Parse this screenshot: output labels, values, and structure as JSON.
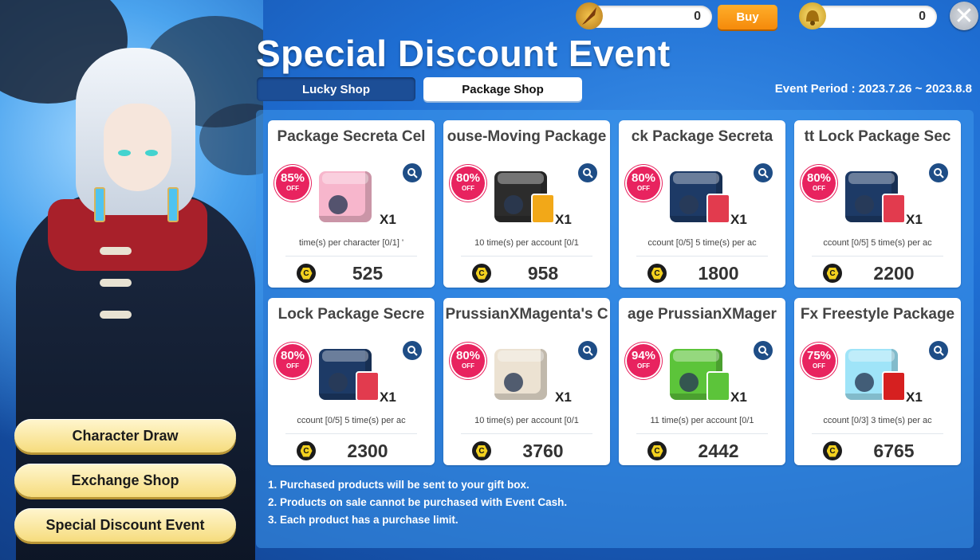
{
  "currency": [
    {
      "icon": "quill-pen-icon",
      "amount": "0"
    },
    {
      "icon": "gold-bell-icon",
      "amount": "0"
    }
  ],
  "buy_label": "Buy",
  "close_icon": "close-icon",
  "title": "Special Discount Event",
  "tabs": {
    "lucky": "Lucky Shop",
    "package": "Package Shop"
  },
  "event_period": "Event Period : 2023.7.26 ~ 2023.8.8",
  "side_menu": [
    "Character Draw",
    "Exchange Shop",
    "Special Discount Event"
  ],
  "off_label": "OFF",
  "products": [
    {
      "name": "Package     Secreta Cel",
      "discount": "85%",
      "qty": "X1",
      "limit": "time(s) per character [0/1]   '",
      "price": "525",
      "box_color": "#f7b6cc",
      "extra_color": ""
    },
    {
      "name": "ouse-Moving Package",
      "discount": "80%",
      "qty": "X1",
      "limit": "10 time(s) per account [0/1",
      "price": "958",
      "box_color": "#2c2c2c",
      "extra_color": "#f2a818"
    },
    {
      "name": "ck Package     Secreta",
      "discount": "80%",
      "qty": "X1",
      "limit": "ccount [0/5]    5 time(s) per ac",
      "price": "1800",
      "box_color": "#1d3a66",
      "extra_color": "#e23b4e"
    },
    {
      "name": "tt Lock Package     Sec",
      "discount": "80%",
      "qty": "X1",
      "limit": "ccount [0/5]    5 time(s) per ac",
      "price": "2200",
      "box_color": "#1d3a66",
      "extra_color": "#e23b4e"
    },
    {
      "name": "Lock Package     Secre",
      "discount": "80%",
      "qty": "X1",
      "limit": "ccount [0/5]    5 time(s) per ac",
      "price": "2300",
      "box_color": "#1d3a66",
      "extra_color": "#e23b4e"
    },
    {
      "name": "PrussianXMagenta's C",
      "discount": "80%",
      "qty": "X1",
      "limit": "10 time(s) per account [0/1",
      "price": "3760",
      "box_color": "#ece2d2",
      "extra_color": ""
    },
    {
      "name": "age     PrussianXMager",
      "discount": "94%",
      "qty": "X1",
      "limit": "11 time(s) per account [0/1",
      "price": "2442",
      "box_color": "#5cc43a",
      "extra_color": "#5cc43a"
    },
    {
      "name": "Fx Freestyle Package",
      "discount": "75%",
      "qty": "X1",
      "limit": "ccount [0/3]    3 time(s) per ac",
      "price": "6765",
      "box_color": "#9fe4f8",
      "extra_color": "#d62020"
    }
  ],
  "notes": [
    "1. Purchased products will be sent to your gift box.",
    "2. Products on sale cannot be purchased with Event Cash.",
    "3. Each product has a purchase limit."
  ]
}
